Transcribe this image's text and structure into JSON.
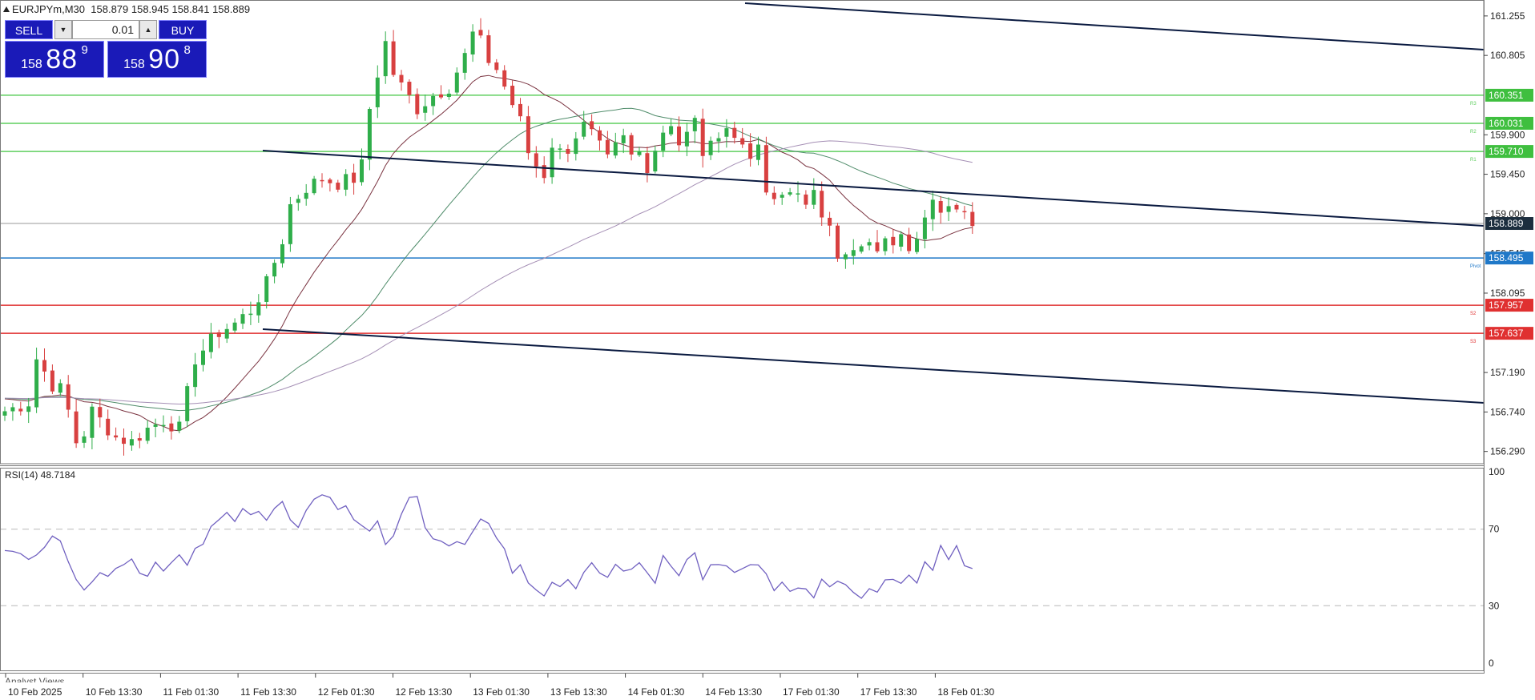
{
  "header": {
    "symbol": "EURJPYm,M30",
    "ohlc": "158.879 158.945 158.841 158.889"
  },
  "trade_panel": {
    "sell_label": "SELL",
    "buy_label": "BUY",
    "volume": "0.01",
    "sell_price": {
      "prefix": "158",
      "main": "88",
      "sup": "9"
    },
    "buy_price": {
      "prefix": "158",
      "main": "90",
      "sup": "8"
    }
  },
  "price_axis": {
    "ticks": [
      "161.255",
      "160.805",
      "159.900",
      "159.450",
      "159.000",
      "158.545",
      "158.095",
      "157.190",
      "156.740",
      "156.290"
    ]
  },
  "levels": [
    {
      "label": "R3",
      "value": "160.351",
      "color": "#5fcf5f",
      "badge_color": "#3fbf3f"
    },
    {
      "label": "R2",
      "value": "160.031",
      "color": "#5fcf5f",
      "badge_color": "#3fbf3f"
    },
    {
      "label": "R1",
      "value": "159.710",
      "color": "#5fcf5f",
      "badge_color": "#3fbf3f"
    },
    {
      "label": "Pivot",
      "value": "158.495",
      "color": "#1f78c8",
      "badge_color": "#1f78c8"
    },
    {
      "label": "S2",
      "value": "157.957",
      "color": "#e03030",
      "badge_color": "#e03030"
    },
    {
      "label": "S3",
      "value": "157.637",
      "color": "#e03030",
      "badge_color": "#e03030"
    }
  ],
  "current_price": {
    "value": "158.889",
    "badge_color": "#1c2e3e"
  },
  "rsi": {
    "label": "RSI(14) 48.7184",
    "ticks": [
      "100",
      "70",
      "30",
      "0"
    ],
    "color": "#7060c0"
  },
  "time_axis": {
    "labels": [
      "10 Feb 2025",
      "10 Feb 13:30",
      "11 Feb 01:30",
      "11 Feb 13:30",
      "12 Feb 01:30",
      "12 Feb 13:30",
      "13 Feb 01:30",
      "13 Feb 13:30",
      "14 Feb 01:30",
      "14 Feb 13:30",
      "17 Feb 01:30",
      "17 Feb 13:30",
      "18 Feb 01:30"
    ]
  },
  "bottom_tab": {
    "label": "Analyst Views"
  },
  "chart_data": {
    "type": "candlestick",
    "instrument": "EURJPYm",
    "timeframe": "M30",
    "ylim": [
      156.15,
      161.4
    ],
    "close_path": [
      [
        0,
        156.75
      ],
      [
        3,
        156.85
      ],
      [
        4,
        157.35
      ],
      [
        6,
        157.05
      ],
      [
        7,
        157.0
      ],
      [
        8,
        156.75
      ],
      [
        9,
        156.4
      ],
      [
        10,
        156.5
      ],
      [
        11,
        156.75
      ],
      [
        12,
        156.65
      ],
      [
        14,
        156.45
      ],
      [
        16,
        156.4
      ],
      [
        18,
        156.55
      ],
      [
        20,
        156.65
      ],
      [
        22,
        156.55
      ],
      [
        23,
        156.95
      ],
      [
        24,
        157.35
      ],
      [
        25,
        157.45
      ],
      [
        27,
        157.65
      ],
      [
        29,
        157.75
      ],
      [
        31,
        157.9
      ],
      [
        33,
        158.2
      ],
      [
        35,
        158.7
      ],
      [
        36,
        159.1
      ],
      [
        38,
        159.3
      ],
      [
        40,
        159.4
      ],
      [
        42,
        159.35
      ],
      [
        44,
        159.4
      ],
      [
        45,
        159.55
      ],
      [
        46,
        160.2
      ],
      [
        47,
        160.6
      ],
      [
        48,
        160.95
      ],
      [
        49,
        160.6
      ],
      [
        50,
        160.45
      ],
      [
        52,
        160.2
      ],
      [
        54,
        160.35
      ],
      [
        56,
        160.45
      ],
      [
        58,
        160.8
      ],
      [
        59,
        161.05
      ],
      [
        60,
        160.95
      ],
      [
        61,
        160.75
      ],
      [
        62,
        160.65
      ],
      [
        63,
        160.45
      ],
      [
        64,
        160.25
      ],
      [
        65,
        160.05
      ],
      [
        66,
        159.7
      ],
      [
        67,
        159.55
      ],
      [
        68,
        159.45
      ],
      [
        69,
        159.8
      ],
      [
        70,
        159.7
      ],
      [
        71,
        159.75
      ],
      [
        72,
        159.9
      ],
      [
        73,
        160.0
      ],
      [
        74,
        159.9
      ],
      [
        75,
        159.75
      ],
      [
        76,
        159.6
      ],
      [
        77,
        159.75
      ],
      [
        78,
        159.85
      ],
      [
        79,
        159.65
      ],
      [
        80,
        159.7
      ],
      [
        81,
        159.55
      ],
      [
        82,
        159.75
      ],
      [
        83,
        159.95
      ],
      [
        84,
        160.05
      ],
      [
        85,
        159.8
      ],
      [
        86,
        159.9
      ],
      [
        87,
        160.05
      ],
      [
        88,
        159.7
      ],
      [
        89,
        159.75
      ],
      [
        90,
        159.95
      ],
      [
        91,
        160.0
      ],
      [
        92,
        159.85
      ],
      [
        93,
        159.8
      ],
      [
        94,
        159.7
      ],
      [
        95,
        159.7
      ],
      [
        96,
        159.25
      ],
      [
        97,
        159.1
      ],
      [
        98,
        159.2
      ],
      [
        100,
        159.3
      ],
      [
        101,
        159.05
      ],
      [
        102,
        159.2
      ],
      [
        103,
        159.0
      ],
      [
        104,
        158.95
      ],
      [
        105,
        158.55
      ],
      [
        106,
        158.5
      ],
      [
        107,
        158.55
      ],
      [
        108,
        158.6
      ],
      [
        110,
        158.62
      ],
      [
        112,
        158.7
      ],
      [
        113,
        158.85
      ],
      [
        114,
        158.65
      ],
      [
        115,
        158.8
      ],
      [
        116,
        158.95
      ],
      [
        117,
        159.1
      ],
      [
        118,
        158.95
      ],
      [
        119,
        159.15
      ],
      [
        120,
        159.05
      ],
      [
        121,
        159.1
      ],
      [
        122,
        158.9
      ]
    ],
    "rsi_path": [
      [
        0,
        58
      ],
      [
        3,
        55
      ],
      [
        5,
        60
      ],
      [
        6,
        67
      ],
      [
        7,
        63
      ],
      [
        9,
        44
      ],
      [
        10,
        39
      ],
      [
        11,
        43
      ],
      [
        12,
        46
      ],
      [
        13,
        44
      ],
      [
        14,
        51
      ],
      [
        15,
        52
      ],
      [
        16,
        55
      ],
      [
        17,
        46
      ],
      [
        18,
        44
      ],
      [
        19,
        52
      ],
      [
        20,
        49
      ],
      [
        21,
        53
      ],
      [
        22,
        56
      ],
      [
        23,
        51
      ],
      [
        24,
        59
      ],
      [
        25,
        62
      ],
      [
        26,
        72
      ],
      [
        27,
        74
      ],
      [
        28,
        78
      ],
      [
        29,
        73
      ],
      [
        30,
        80
      ],
      [
        31,
        77
      ],
      [
        32,
        79
      ],
      [
        33,
        76
      ],
      [
        34,
        80
      ],
      [
        35,
        83
      ],
      [
        36,
        76
      ],
      [
        37,
        71
      ],
      [
        38,
        80
      ],
      [
        39,
        86
      ],
      [
        40,
        89
      ],
      [
        41,
        87
      ],
      [
        42,
        81
      ],
      [
        43,
        83
      ],
      [
        44,
        76
      ],
      [
        45,
        73
      ],
      [
        46,
        70
      ],
      [
        47,
        75
      ],
      [
        48,
        62
      ],
      [
        49,
        67
      ],
      [
        50,
        79
      ],
      [
        51,
        86
      ],
      [
        52,
        88
      ],
      [
        53,
        72
      ],
      [
        54,
        66
      ],
      [
        55,
        65
      ],
      [
        56,
        61
      ],
      [
        57,
        64
      ],
      [
        58,
        62
      ],
      [
        59,
        70
      ],
      [
        60,
        75
      ],
      [
        61,
        72
      ],
      [
        62,
        64
      ],
      [
        63,
        60
      ],
      [
        64,
        47
      ],
      [
        65,
        51
      ],
      [
        66,
        43
      ],
      [
        67,
        37
      ],
      [
        68,
        35
      ],
      [
        69,
        43
      ],
      [
        70,
        40
      ],
      [
        71,
        45
      ],
      [
        72,
        40
      ],
      [
        73,
        47
      ],
      [
        74,
        52
      ],
      [
        75,
        48
      ],
      [
        76,
        44
      ],
      [
        77,
        51
      ],
      [
        78,
        47
      ],
      [
        80,
        52
      ],
      [
        81,
        47
      ],
      [
        82,
        41
      ],
      [
        83,
        55
      ],
      [
        84,
        50
      ],
      [
        85,
        46
      ],
      [
        86,
        53
      ],
      [
        87,
        57
      ],
      [
        88,
        43
      ],
      [
        89,
        50
      ],
      [
        90,
        53
      ],
      [
        91,
        52
      ],
      [
        92,
        47
      ],
      [
        93,
        48
      ],
      [
        95,
        52
      ],
      [
        96,
        48
      ],
      [
        97,
        37
      ],
      [
        98,
        43
      ],
      [
        99,
        37
      ],
      [
        100,
        38
      ],
      [
        101,
        40
      ],
      [
        102,
        35
      ],
      [
        103,
        43
      ],
      [
        104,
        41
      ],
      [
        105,
        44
      ],
      [
        106,
        40
      ],
      [
        107,
        36
      ],
      [
        108,
        33
      ],
      [
        109,
        39
      ],
      [
        110,
        37
      ],
      [
        111,
        43
      ],
      [
        112,
        45
      ],
      [
        113,
        41
      ],
      [
        114,
        47
      ],
      [
        115,
        43
      ],
      [
        116,
        52
      ],
      [
        117,
        48
      ],
      [
        118,
        63
      ],
      [
        119,
        55
      ],
      [
        120,
        61
      ],
      [
        121,
        52
      ],
      [
        122,
        50
      ]
    ],
    "time_labels": [
      "10 Feb 2025",
      "10 Feb 13:30",
      "11 Feb 01:30",
      "11 Feb 13:30",
      "12 Feb 01:30",
      "12 Feb 13:30",
      "13 Feb 01:30",
      "13 Feb 13:30",
      "14 Feb 01:30",
      "14 Feb 13:30",
      "17 Feb 01:30",
      "17 Feb 13:30",
      "18 Feb 01:30"
    ]
  }
}
